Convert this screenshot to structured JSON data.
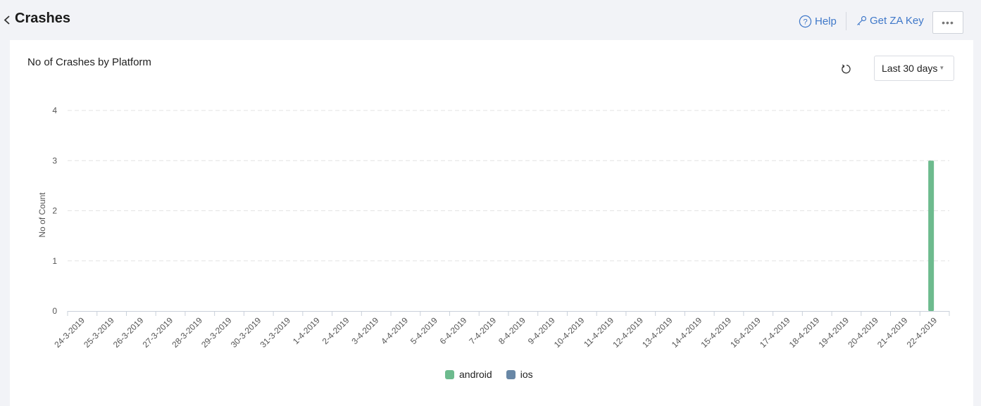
{
  "header": {
    "title": "Crashes",
    "help_label": "Help",
    "zakey_label": "Get ZA Key",
    "more_label": "•••"
  },
  "card": {
    "title": "No of Crashes by Platform",
    "range_selected": "Last 30 days"
  },
  "colors": {
    "link": "#3f78c9",
    "android": "#6dbb8e",
    "ios": "#6887a6"
  },
  "chart_data": {
    "type": "bar",
    "title": "No of Crashes by Platform",
    "xlabel": "",
    "ylabel": "No of Count",
    "ylim": [
      0,
      4
    ],
    "yticks": [
      "0",
      "1",
      "2",
      "3",
      "4"
    ],
    "grid": true,
    "legend_position": "bottom",
    "categories": [
      "24-3-2019",
      "25-3-2019",
      "26-3-2019",
      "27-3-2019",
      "28-3-2019",
      "29-3-2019",
      "30-3-2019",
      "31-3-2019",
      "1-4-2019",
      "2-4-2019",
      "3-4-2019",
      "4-4-2019",
      "5-4-2019",
      "6-4-2019",
      "7-4-2019",
      "8-4-2019",
      "9-4-2019",
      "10-4-2019",
      "11-4-2019",
      "12-4-2019",
      "13-4-2019",
      "14-4-2019",
      "15-4-2019",
      "16-4-2019",
      "17-4-2019",
      "18-4-2019",
      "19-4-2019",
      "20-4-2019",
      "21-4-2019",
      "22-4-2019"
    ],
    "series": [
      {
        "name": "android",
        "color": "#6dbb8e",
        "values": [
          0,
          0,
          0,
          0,
          0,
          0,
          0,
          0,
          0,
          0,
          0,
          0,
          0,
          0,
          0,
          0,
          0,
          0,
          0,
          0,
          0,
          0,
          0,
          0,
          0,
          0,
          0,
          0,
          0,
          3
        ]
      },
      {
        "name": "ios",
        "color": "#6887a6",
        "values": [
          0,
          0,
          0,
          0,
          0,
          0,
          0,
          0,
          0,
          0,
          0,
          0,
          0,
          0,
          0,
          0,
          0,
          0,
          0,
          0,
          0,
          0,
          0,
          0,
          0,
          0,
          0,
          0,
          0,
          0
        ]
      }
    ]
  }
}
